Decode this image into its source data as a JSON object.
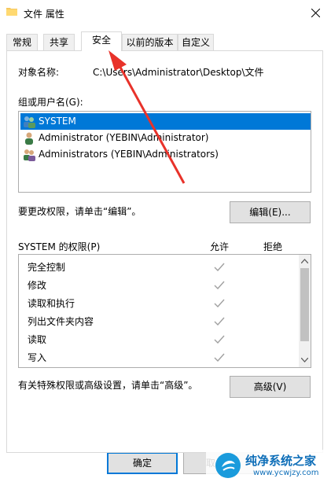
{
  "window": {
    "title": "文件 属性",
    "close_icon": "close-icon"
  },
  "tabs": [
    {
      "label": "常规"
    },
    {
      "label": "共享"
    },
    {
      "label": "安全",
      "active": true
    },
    {
      "label": "以前的版本"
    },
    {
      "label": "自定义"
    }
  ],
  "security": {
    "object_name_label": "对象名称:",
    "object_name_value": "C:\\Users\\Administrator\\Desktop\\文件",
    "groups_label": "组或用户名(G):",
    "users": [
      {
        "name": "SYSTEM",
        "selected": true,
        "icon": "users-group-icon"
      },
      {
        "name": "Administrator (YEBIN\\Administrator)",
        "selected": false,
        "icon": "user-icon"
      },
      {
        "name": "Administrators (YEBIN\\Administrators)",
        "selected": false,
        "icon": "users-group-icon"
      }
    ],
    "edit_hint": "要更改权限，请单击“编辑”。",
    "edit_button": "编辑(E)...",
    "permissions_label": "SYSTEM 的权限(P)",
    "allow_header": "允许",
    "deny_header": "拒绝",
    "permissions": [
      {
        "name": "完全控制",
        "allow": true,
        "deny": false
      },
      {
        "name": "修改",
        "allow": true,
        "deny": false
      },
      {
        "name": "读取和执行",
        "allow": true,
        "deny": false
      },
      {
        "name": "列出文件夹内容",
        "allow": true,
        "deny": false
      },
      {
        "name": "读取",
        "allow": true,
        "deny": false
      },
      {
        "name": "写入",
        "allow": true,
        "deny": false
      }
    ],
    "advanced_hint": "有关特殊权限或高级设置，请单击“高级”。",
    "advanced_button": "高级(V)"
  },
  "footer": {
    "ok_button": "确定",
    "cancel_button_partial": "取"
  },
  "watermark": {
    "text": "纯净系统之家",
    "url": "www.ycwjzy.com"
  },
  "colors": {
    "selection": "#0078d7",
    "annotation_arrow": "#e8322a",
    "check": "#a0a0a0"
  }
}
